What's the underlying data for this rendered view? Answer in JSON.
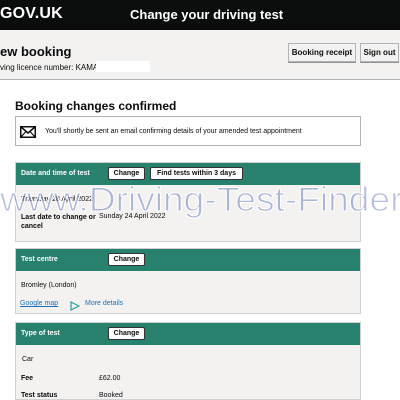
{
  "header": {
    "logo": "GOV.UK",
    "service_name": "Change your driving test"
  },
  "subheader": {
    "title": "ew booking",
    "licence_label": "ving licence number: KAMAR",
    "receipt_button": "Booking receipt",
    "signout_button": "Sign out"
  },
  "main": {
    "page_title": "Booking changes confirmed",
    "notice_icon": "envelope-icon",
    "notice_text": "You'll shortly be sent an email confirming details of your amended test appointment"
  },
  "test_datetime": {
    "heading": "Date and time of test",
    "change_label": "Change",
    "find_label": "Find tests within 3 days",
    "value": "Thursday 28 April 2022",
    "cancel_label": "Last date to change or cancel",
    "cancel_value": "Sunday 24 April 2022"
  },
  "test_centre": {
    "heading": "Test centre",
    "change_label": "Change",
    "value": "Bromley (London)",
    "map_link": "Google map",
    "more_icon": "play-triangle-icon",
    "more_link": "More details"
  },
  "test_type": {
    "heading": "Type of test",
    "change_label": "Change",
    "vehicle": "Car",
    "fee_label": "Fee",
    "fee_value": "£62.00",
    "status_label": "Test status",
    "status_value": "Booked"
  },
  "watermark": {
    "text": "www.Driving-Test-Finder.co"
  },
  "colors": {
    "header_bg": "#0b0c0c",
    "card_header": "#28816c",
    "link": "#1d70b8",
    "watermark": "#1a3aa6"
  }
}
